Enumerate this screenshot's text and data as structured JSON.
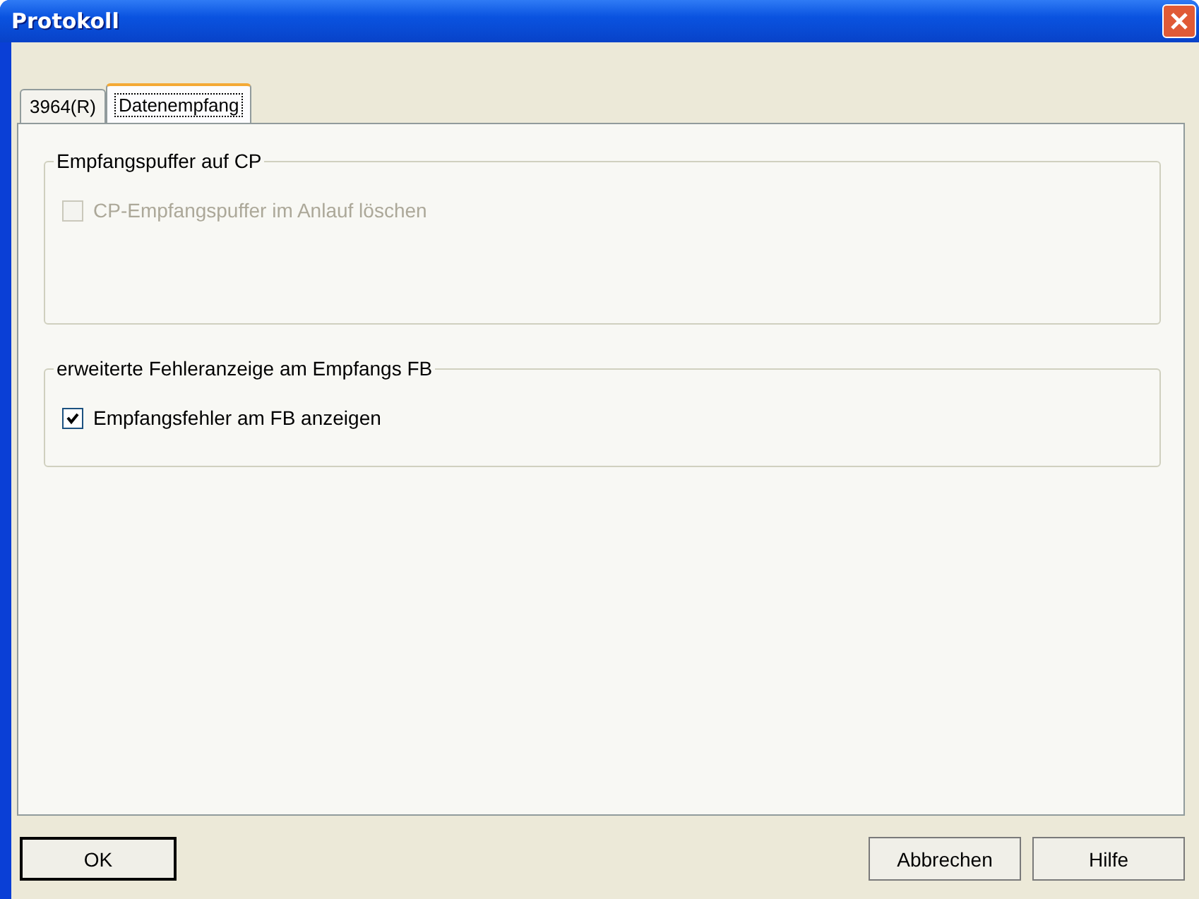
{
  "window": {
    "title": "Protokoll"
  },
  "tabs": [
    {
      "label": "3964(R)",
      "selected": false
    },
    {
      "label": "Datenempfang",
      "selected": true
    }
  ],
  "groups": [
    {
      "title": "Empfangspuffer auf CP",
      "checkboxes": [
        {
          "label": "CP-Empfangspuffer im Anlauf löschen",
          "checked": false,
          "disabled": true
        }
      ]
    },
    {
      "title": "erweiterte Fehleranzeige am Empfangs FB",
      "checkboxes": [
        {
          "label": "Empfangsfehler am FB anzeigen",
          "checked": true,
          "disabled": false
        }
      ]
    }
  ],
  "buttons": [
    {
      "label": "OK",
      "default": true
    },
    {
      "label": "Abbrechen",
      "default": false
    },
    {
      "label": "Hilfe",
      "default": false
    }
  ]
}
